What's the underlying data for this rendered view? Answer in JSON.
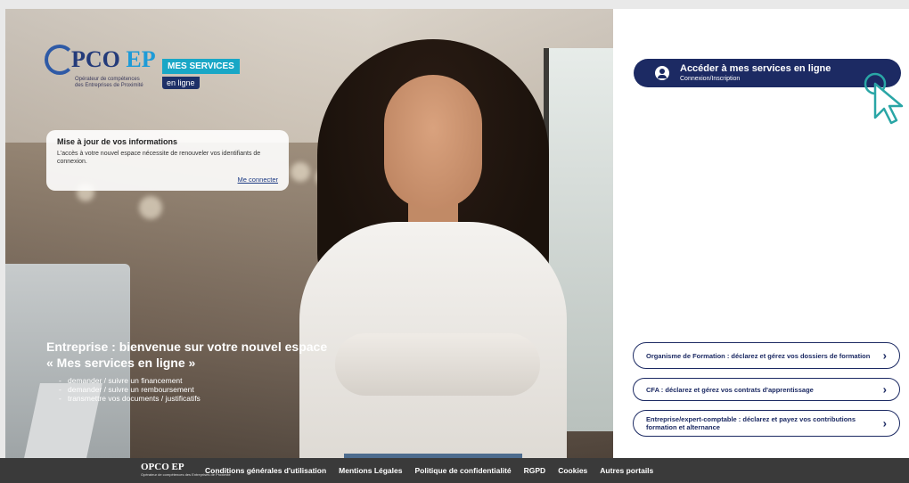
{
  "logo": {
    "name_prefix": "PCO",
    "name_suffix": "EP",
    "tagline_line1": "Opérateur de compétences",
    "tagline_line2": "des Entreprises de Proximité"
  },
  "badge": {
    "line1": "MES SERVICES",
    "line2": "en ligne"
  },
  "info_card": {
    "title": "Mise à jour de vos informations",
    "text": "L'accès à votre nouvel espace nécessite de renouveler vos identifiants de connexion.",
    "link": "Me connecter"
  },
  "welcome": {
    "line1": "Entreprise : bienvenue sur votre nouvel espace",
    "line2": "« Mes services en ligne »",
    "items": [
      "demander / suivre un financement",
      "demander / suivre un remboursement",
      "transmettre vos documents / justificatifs"
    ]
  },
  "access": {
    "title": "Accéder à mes services en ligne",
    "subtitle": "Connexion/Inscription",
    "icon": "user-circle-icon"
  },
  "options": [
    {
      "label": "Organisme de Formation : déclarez et gérez vos dossiers de formation",
      "chevron": "›"
    },
    {
      "label": "CFA : déclarez et gérez vos contrats d'apprentissage",
      "chevron": "›"
    },
    {
      "label": "Entreprise/expert-comptable : déclarez et payez vos contributions formation et alternance",
      "chevron": "›"
    }
  ],
  "footer": {
    "logo_text": "OPCO EP",
    "logo_sub": "Opérateur de compétences des Entreprises de Proximité",
    "links": [
      "Conditions générales d'utilisation",
      "Mentions Légales",
      "Politique de confidentialité",
      "RGPD",
      "Cookies",
      "Autres portails"
    ]
  },
  "colors": {
    "navy": "#1c2a63",
    "accent_blue": "#19a7c6",
    "cursor_teal": "#2aa6a6",
    "footer_bg": "#3a3a3a"
  }
}
